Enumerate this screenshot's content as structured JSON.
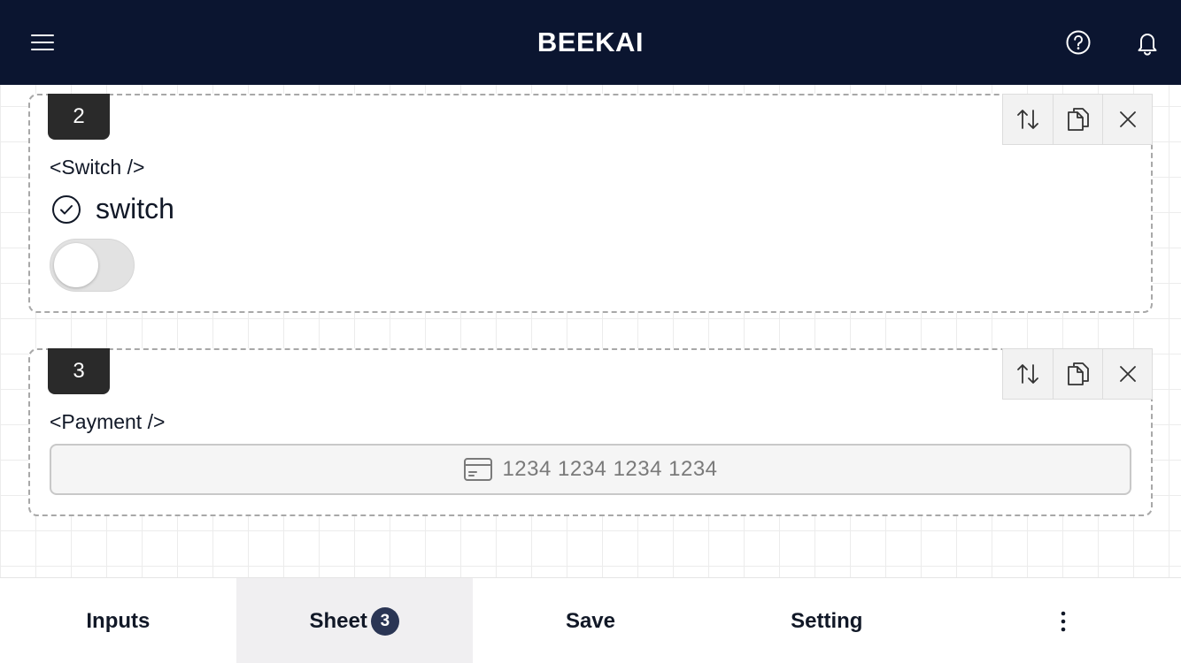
{
  "header": {
    "title": "BEEKAI",
    "menu_icon": "hamburger-menu-icon",
    "help_icon": "question-circle-icon",
    "bell_icon": "bell-icon"
  },
  "cards": [
    {
      "index": "2",
      "component": "<Switch />",
      "field_label": "switch",
      "field_icon": "check-circle-icon",
      "toggle_state": "off"
    },
    {
      "index": "3",
      "component": "<Payment />",
      "payment_placeholder": "1234 1234 1234 1234",
      "card_icon": "credit-card-icon"
    }
  ],
  "card_tools": [
    "reorder-icon",
    "duplicate-icon",
    "close-icon"
  ],
  "bottom_tabs": {
    "inputs": "Inputs",
    "sheet": "Sheet",
    "sheet_count": "3",
    "save": "Save",
    "setting": "Setting",
    "more_icon": "vertical-ellipsis-icon"
  },
  "colors": {
    "header_bg": "#0b1530",
    "badge_bg": "#2a2a2a",
    "count_bg": "#2a3554",
    "active_tab_bg": "#f0eff1"
  }
}
